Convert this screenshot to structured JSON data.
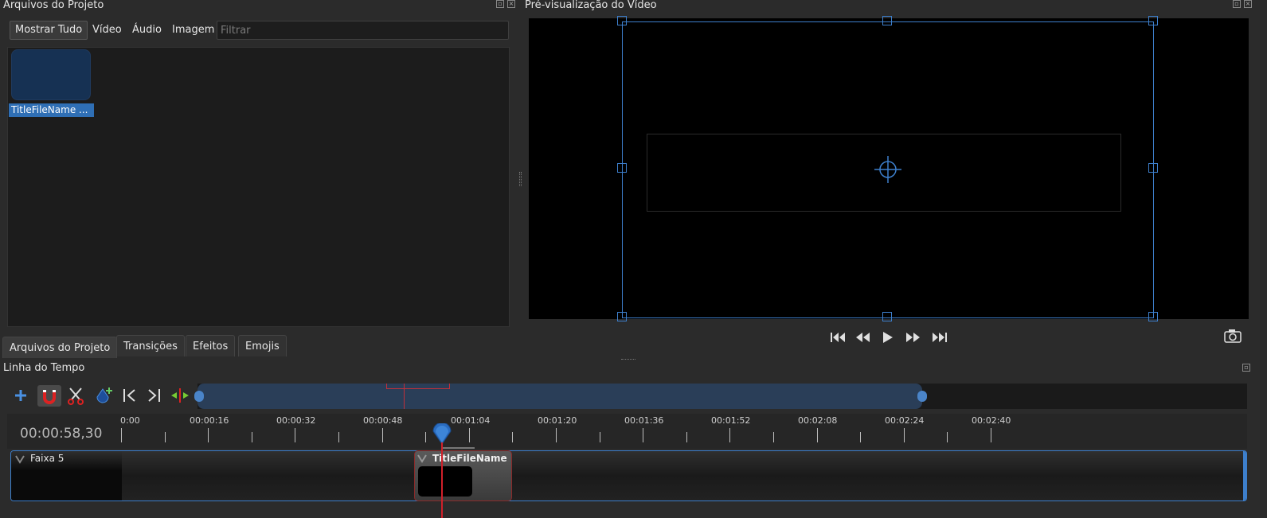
{
  "project_files_panel": {
    "title": "Arquivos do Projeto",
    "filters": {
      "show_all": "Mostrar Tudo",
      "video": "Vídeo",
      "audio": "Áudio",
      "image": "Imagem"
    },
    "search_placeholder": "Filtrar",
    "files": [
      {
        "name": "TitleFileName ..."
      }
    ]
  },
  "preview_panel": {
    "title": "Pré-visualização do Vídeo"
  },
  "bottom_tabs": {
    "project_files": "Arquivos do Projeto",
    "transitions": "Transições",
    "effects": "Efeitos",
    "emojis": "Emojis"
  },
  "timeline_panel": {
    "title": "Linha do Tempo",
    "current_time": "00:00:58,30",
    "ruler_labels": [
      "0:00",
      "00:00:16",
      "00:00:32",
      "00:00:48",
      "00:01:04",
      "00:01:20",
      "00:01:36",
      "00:01:52",
      "00:02:08",
      "00:02:24",
      "00:02:40"
    ],
    "tracks": [
      {
        "name": "Faixa 5",
        "clips": [
          {
            "name": "TitleFileName (..."
          }
        ]
      }
    ]
  },
  "colors": {
    "accent": "#3d7fcc",
    "selection": "#2f6fb5",
    "playhead": "#d0202a",
    "background": "#2b2b2b"
  }
}
